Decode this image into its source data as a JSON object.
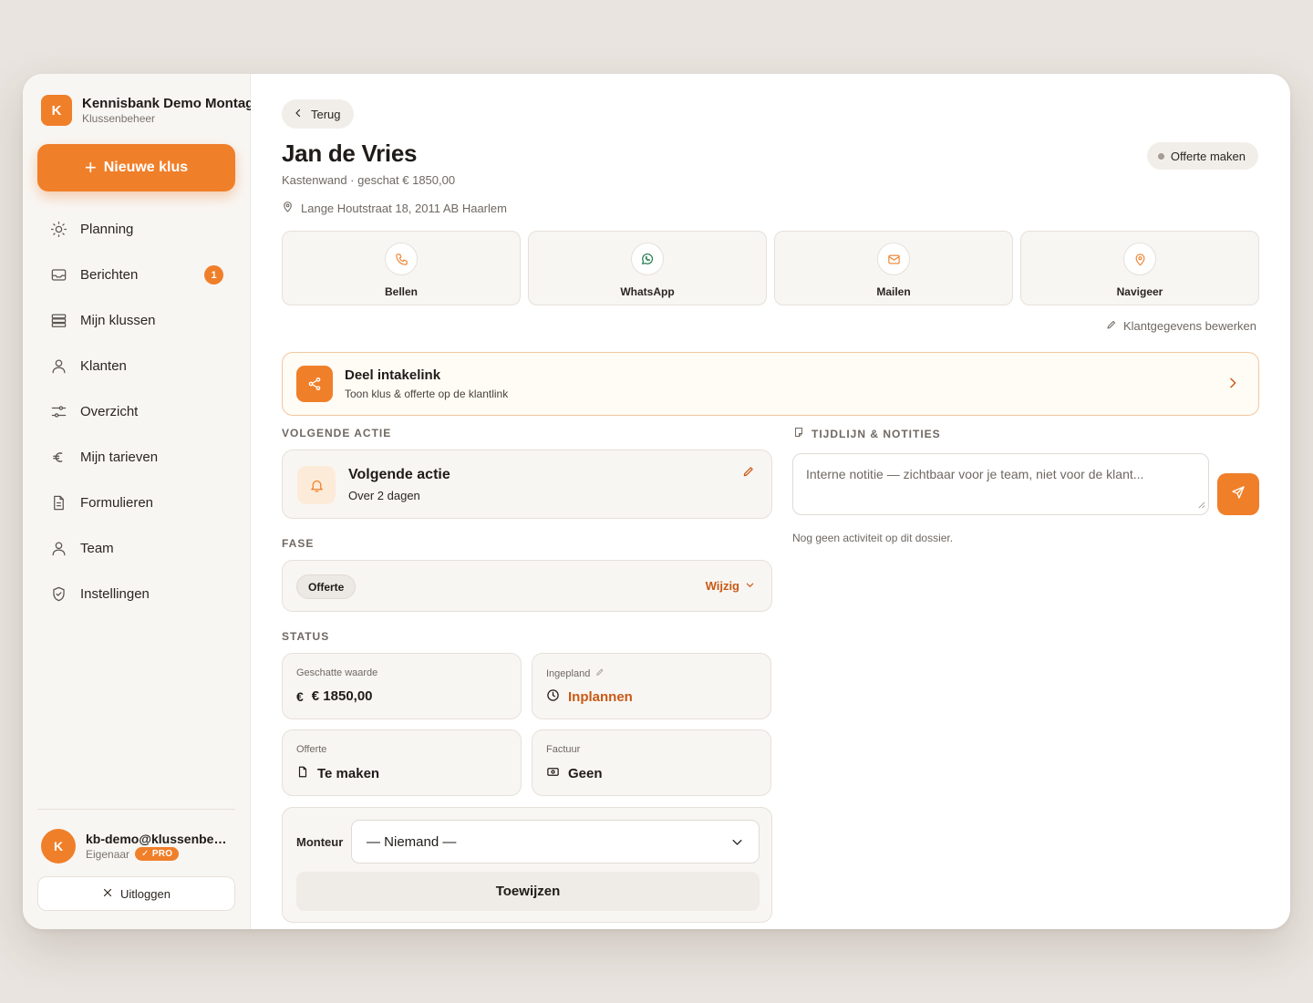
{
  "brand": {
    "initial": "K",
    "name": "Kennisbank Demo Montage",
    "subtitle": "Klussenbeheer"
  },
  "sidebar": {
    "new_button": "Nieuwe klus",
    "items": [
      {
        "label": "Planning",
        "icon": "sun-icon"
      },
      {
        "label": "Berichten",
        "icon": "inbox-icon",
        "badge": "1"
      },
      {
        "label": "Mijn klussen",
        "icon": "stack-icon"
      },
      {
        "label": "Klanten",
        "icon": "user-icon"
      },
      {
        "label": "Overzicht",
        "icon": "sliders-icon"
      },
      {
        "label": "Mijn tarieven",
        "icon": "euro-icon"
      },
      {
        "label": "Formulieren",
        "icon": "document-icon"
      },
      {
        "label": "Team",
        "icon": "user-icon"
      },
      {
        "label": "Instellingen",
        "icon": "shield-icon"
      }
    ],
    "user": {
      "initial": "K",
      "email": "kb-demo@klussenbeheer.nl",
      "role": "Eigenaar",
      "plan": "PRO"
    },
    "logout": "Uitloggen"
  },
  "header": {
    "back": "Terug",
    "title": "Jan de Vries",
    "subtitle": "Kastenwand · geschat € 1850,00",
    "address": "Lange Houtstraat 18, 2011 AB Haarlem",
    "chip": "Offerte maken"
  },
  "actions": [
    {
      "label": "Bellen",
      "icon": "phone-icon"
    },
    {
      "label": "WhatsApp",
      "icon": "whatsapp-icon"
    },
    {
      "label": "Mailen",
      "icon": "mail-icon"
    },
    {
      "label": "Navigeer",
      "icon": "map-pin-icon"
    }
  ],
  "edit_customer": "Klantgegevens bewerken",
  "intake": {
    "title": "Deel intakelink",
    "subtitle": "Toon klus & offerte op de klantlink"
  },
  "next_action": {
    "section": "VOLGENDE ACTIE",
    "title": "Volgende actie",
    "subtitle": "Over 2 dagen"
  },
  "phase": {
    "section": "FASE",
    "value": "Offerte",
    "change": "Wijzig"
  },
  "status": {
    "section": "STATUS",
    "cards": [
      {
        "label": "Geschatte waarde",
        "value": "€ 1850,00",
        "icon": "euro-icon"
      },
      {
        "label": "Ingepland",
        "value": "Inplannen",
        "icon": "clock-icon"
      },
      {
        "label": "Offerte",
        "value": "Te maken",
        "icon": "document-icon"
      },
      {
        "label": "Factuur",
        "value": "Geen",
        "icon": "cash-icon"
      }
    ]
  },
  "monteur": {
    "label": "Monteur",
    "selected": "— Niemand —",
    "assign": "Toewijzen"
  },
  "timeline": {
    "section": "TIJDLIJN & NOTITIES",
    "placeholder": "Interne notitie — zichtbaar voor je team, niet voor de klant...",
    "empty": "Nog geen activiteit op dit dossier."
  },
  "colors": {
    "accent": "#f07f2a",
    "accent_text": "#c85a15",
    "whatsapp": "#1f7a4d"
  }
}
